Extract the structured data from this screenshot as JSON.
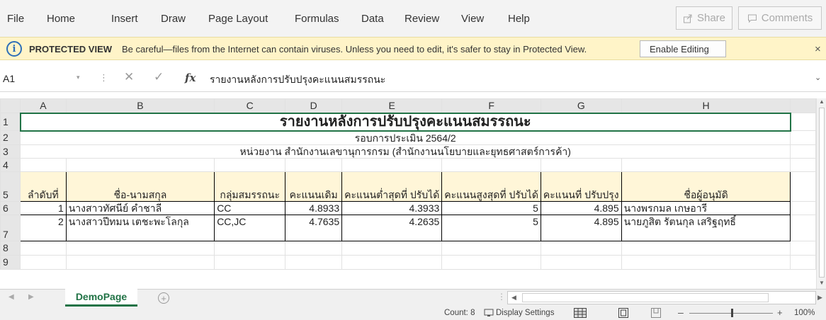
{
  "menu": {
    "items": [
      "File",
      "Home",
      "Insert",
      "Draw",
      "Page Layout",
      "Formulas",
      "Data",
      "Review",
      "View",
      "Help"
    ],
    "share_label": "Share",
    "comments_label": "Comments"
  },
  "protected_view": {
    "title": "PROTECTED VIEW",
    "message": "Be careful—files from the Internet can contain viruses. Unless you need to edit, it's safer to stay in Protected View.",
    "enable_label": "Enable Editing",
    "close_glyph": "×"
  },
  "formula_bar": {
    "name_box": "A1",
    "fx": "fx",
    "content": "รายงานหลังการปรับปรุงคะแนนสมรรถนะ"
  },
  "sheet": {
    "columns": [
      "A",
      "B",
      "C",
      "D",
      "E",
      "F",
      "G",
      "H"
    ],
    "rows": [
      "1",
      "2",
      "3",
      "4",
      "5",
      "6",
      "7",
      "8",
      "9"
    ],
    "title": "รายงานหลังการปรับปรุงคะแนนสมรรถนะ",
    "subtitle": "รอบการประเมิน 2564/2",
    "agency": "หน่วยงาน สำนักงานเลขานุการกรม (สำนักงานนโยบายและยุทธศาสตร์การค้า)",
    "headers": [
      "ลำดับที่",
      "ชื่อ-นามสกุล",
      "กลุ่มสมรรถนะ",
      "คะแนนเดิม",
      "คะแนนต่ำสุดที่ ปรับได้",
      "คะแนนสูงสุดที่ ปรับได้",
      "คะแนนที่ ปรับปรุง",
      "ชื่อผู้อนุมัดิ"
    ],
    "data_rows": [
      [
        "1",
        "นางสาวทัศนีย์ คำชาลี",
        "CC",
        "4.8933",
        "4.3933",
        "5",
        "4.895",
        "นางพรกมล เกษอารี"
      ],
      [
        "2",
        "นางสาวปีทมน เตชะพะโลกุล",
        "CC,JC",
        "4.7635",
        "4.2635",
        "5",
        "4.895",
        "นายภูสิต รัตนกุล เสริฐฤทธิ์"
      ]
    ]
  },
  "tabs": {
    "sheet_name": "DemoPage",
    "add_glyph": "+"
  },
  "status": {
    "count": "Count: 8",
    "display_settings": "Display Settings",
    "zoom": "100%"
  },
  "colors": {
    "accent": "#217346",
    "protected_bg": "#fff4c8",
    "header_fill": "#fff6d8"
  }
}
